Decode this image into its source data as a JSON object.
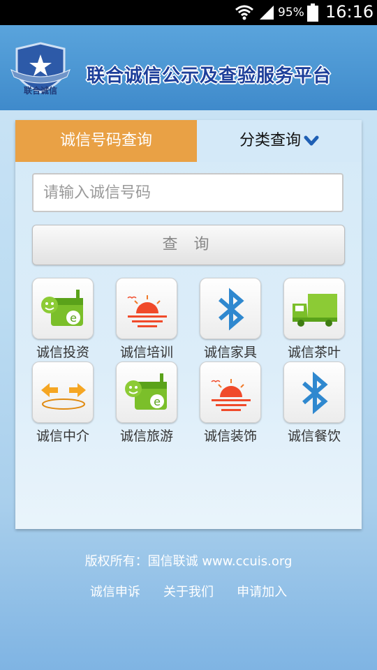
{
  "status_bar": {
    "battery": "95%",
    "time": "16:16"
  },
  "header": {
    "logo_text": "联合诚信",
    "title": "联合诚信公示及查验服务平台"
  },
  "tabs": [
    {
      "label": "诚信号码查询"
    },
    {
      "label": "分类查询"
    }
  ],
  "search": {
    "placeholder": "请输入诚信号码",
    "button_label": "查 询"
  },
  "categories": [
    {
      "label": "诚信投资",
      "icon": "green-shop-e-icon"
    },
    {
      "label": "诚信培训",
      "icon": "sunset-icon"
    },
    {
      "label": "诚信家具",
      "icon": "bluetooth-icon"
    },
    {
      "label": "诚信茶叶",
      "icon": "truck-icon"
    },
    {
      "label": "诚信中介",
      "icon": "exchange-arrows-icon"
    },
    {
      "label": "诚信旅游",
      "icon": "green-shop-e-icon"
    },
    {
      "label": "诚信装饰",
      "icon": "sunset-icon"
    },
    {
      "label": "诚信餐饮",
      "icon": "bluetooth-icon"
    }
  ],
  "footer": {
    "copyright": "版权所有：国信联诚 www.ccuis.org",
    "links": [
      {
        "label": "诚信申诉"
      },
      {
        "label": "关于我们"
      },
      {
        "label": "申请加入"
      }
    ]
  },
  "colors": {
    "active_tab": "#e9a145",
    "header_title": "#1d3f9a",
    "header_bg": "#4a95d2"
  }
}
